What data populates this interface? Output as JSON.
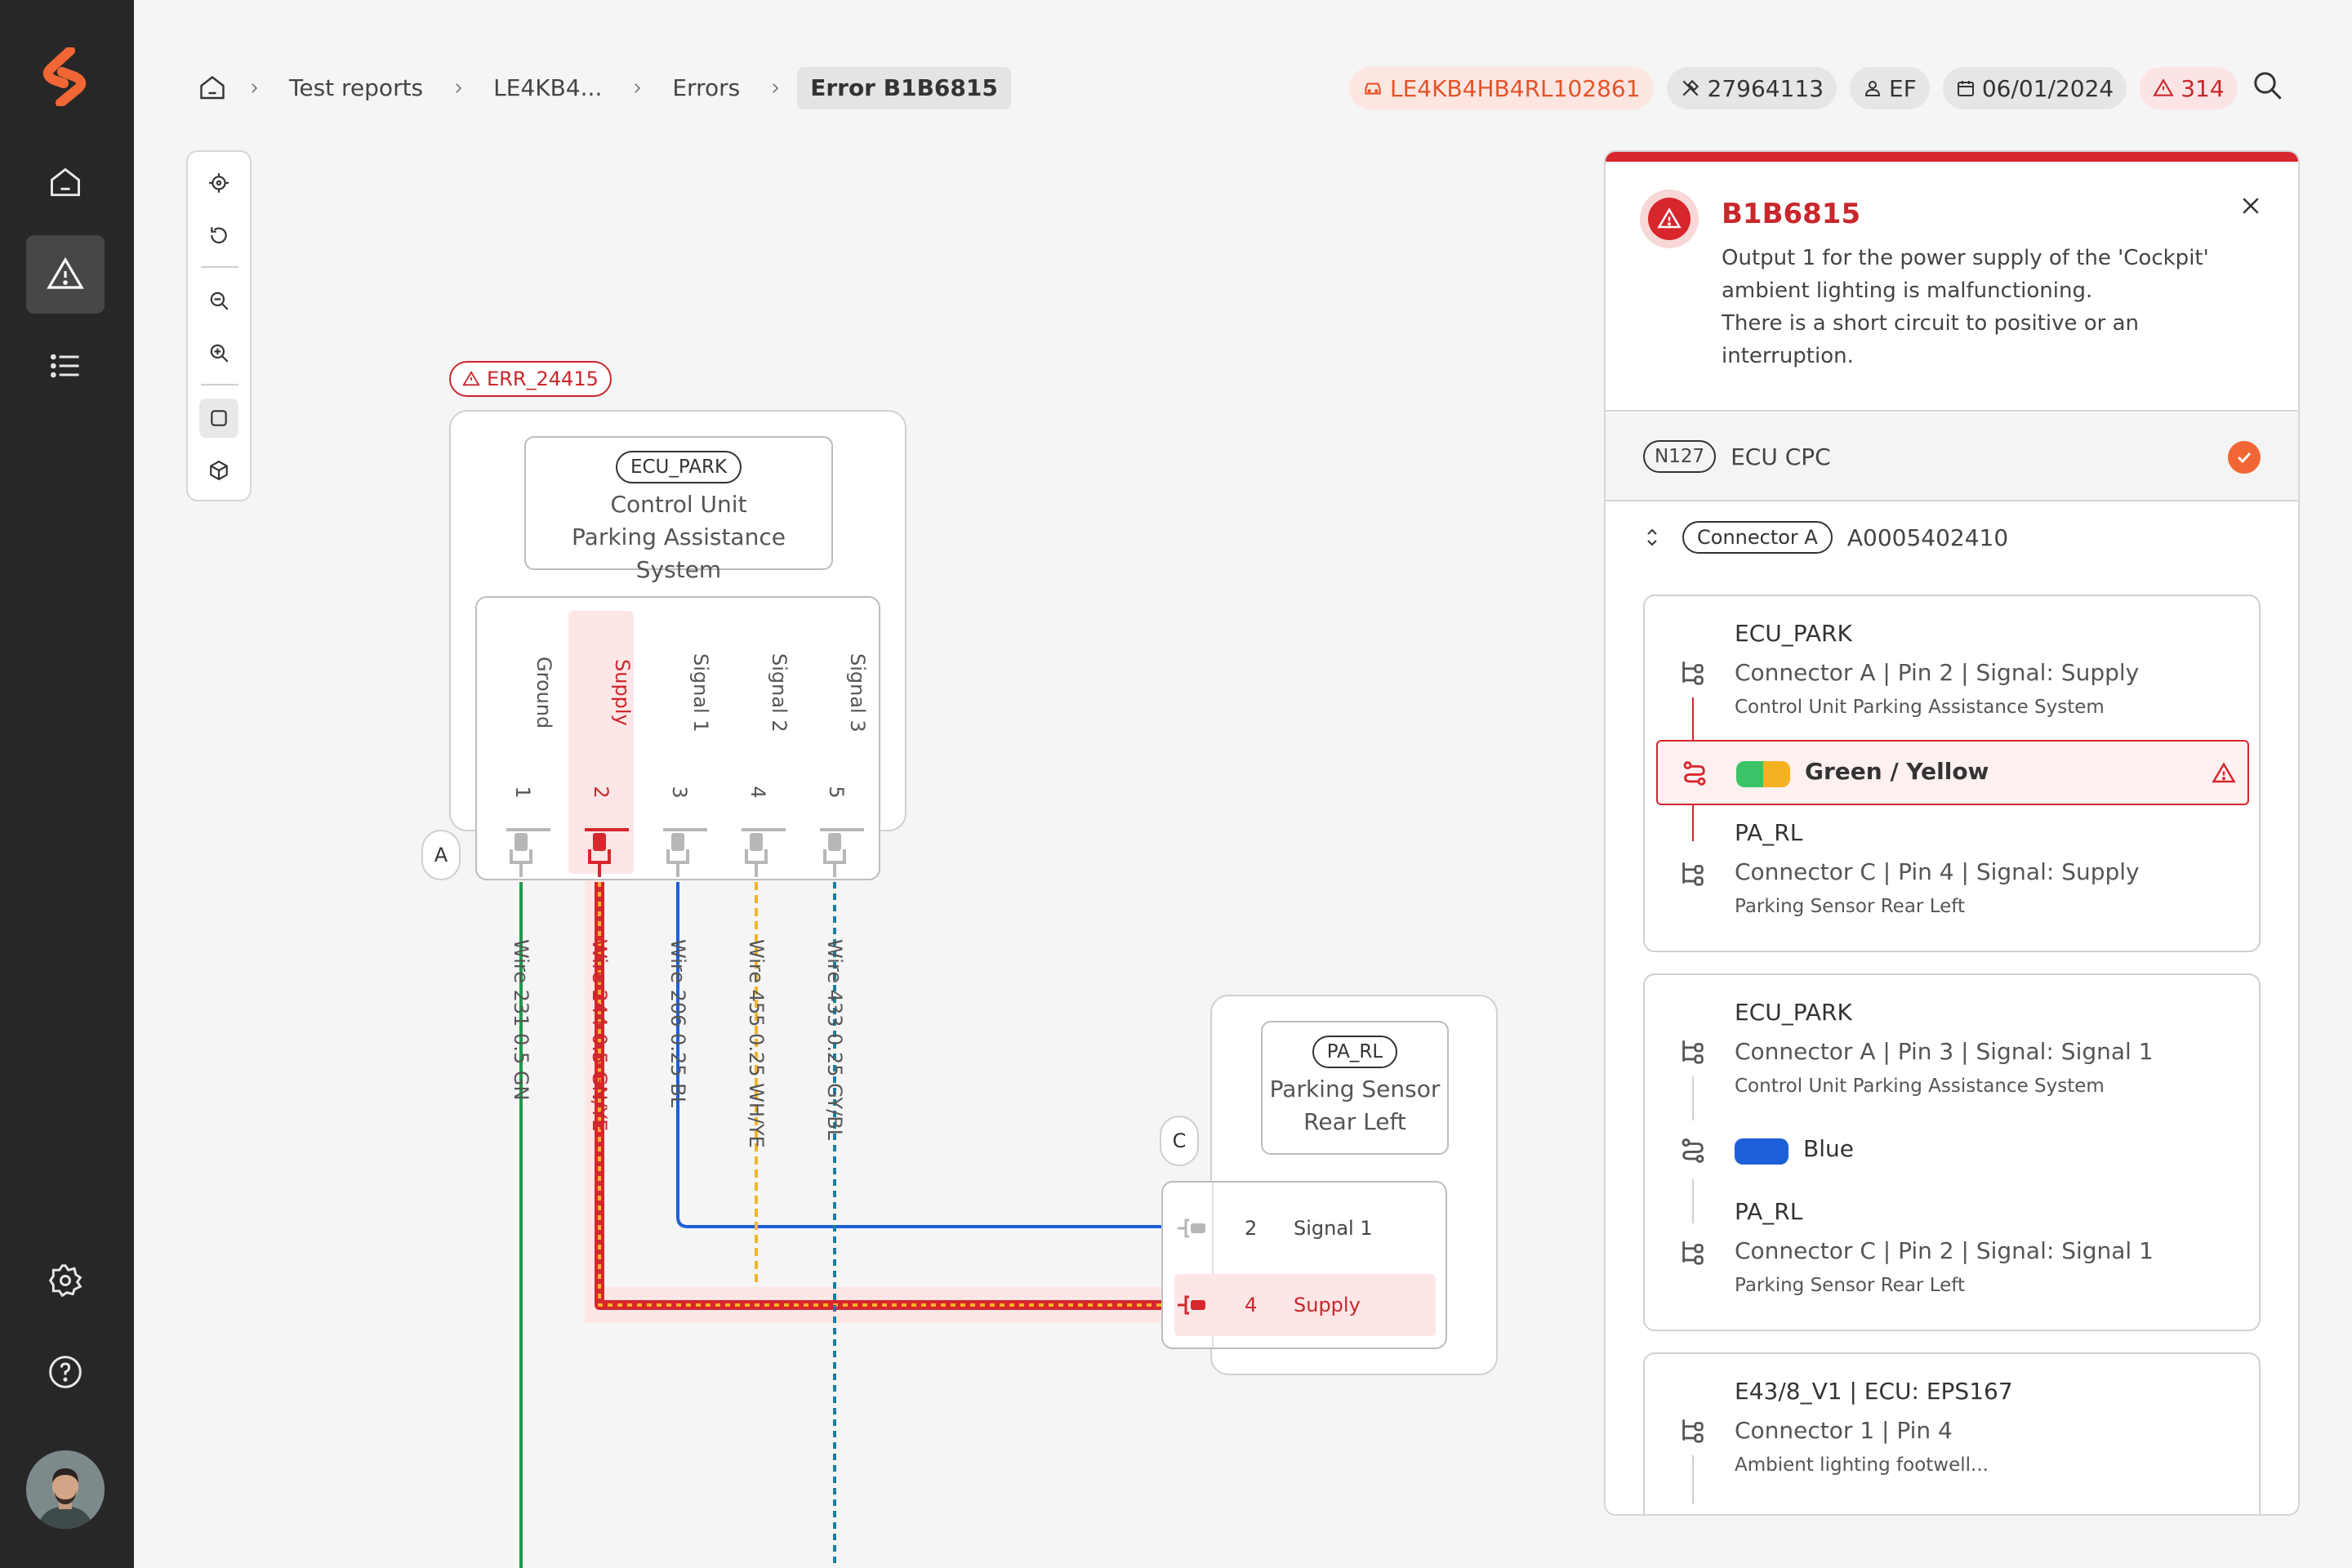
{
  "breadcrumbs": [
    "Test reports",
    "LE4KB4...",
    "Errors",
    "Error B1B6815"
  ],
  "chips": {
    "vin": "LE4KB4HB4RL102861",
    "order": "27964113",
    "user": "EF",
    "date": "06/01/2024",
    "errors": "314"
  },
  "diagram": {
    "error_tag": "ERR_24415",
    "ecu": {
      "code": "ECU_PARK",
      "line1": "Control Unit",
      "line2": "Parking Assistance System",
      "connector": "A"
    },
    "pins": [
      {
        "label": "Ground",
        "num": "1"
      },
      {
        "label": "Supply",
        "num": "2"
      },
      {
        "label": "Signal 1",
        "num": "3"
      },
      {
        "label": "Signal 2",
        "num": "4"
      },
      {
        "label": "Signal 3",
        "num": "5"
      }
    ],
    "wires": [
      {
        "label": "Wire 231  0.5  GN",
        "color": "#1e9a4b"
      },
      {
        "label": "Wire 244  0.5  GN/YE",
        "color": "#d7262c"
      },
      {
        "label": "Wire 206  0.25  BL",
        "color": "#1d5fd8"
      },
      {
        "label": "Wire 455  0.25  WH/YE",
        "color": "#f2b528"
      },
      {
        "label": "Wire 433  0.25  GY/BL",
        "color": "#1a7fa0"
      }
    ],
    "sensor": {
      "code": "PA_RL",
      "line1": "Parking Sensor",
      "line2": "Rear Left",
      "connector": "C"
    },
    "sensor_pins": [
      {
        "num": "2",
        "label": "Signal 1"
      },
      {
        "num": "4",
        "label": "Supply"
      }
    ]
  },
  "panel": {
    "code": "B1B6815",
    "desc1": "Output 1 for the power supply of the 'Cockpit' ambient lighting is malfunctioning.",
    "desc2": "There is a short circuit to positive or an interruption.",
    "ecu_badge": "N127",
    "ecu_name": "ECU CPC",
    "connector_badge": "Connector A",
    "connector_part": "A0005402410",
    "cards": [
      {
        "from_name": "ECU_PARK",
        "from_detail": "Connector A | Pin 2 | Signal: Supply",
        "from_desc": "Control Unit Parking Assistance System",
        "wire": "Green / Yellow",
        "to_name": "PA_RL",
        "to_detail": "Connector C | Pin 4 | Signal: Supply",
        "to_desc": "Parking Sensor Rear Left"
      },
      {
        "from_name": "ECU_PARK",
        "from_detail": "Connector A | Pin 3 | Signal: Signal 1",
        "from_desc": "Control Unit Parking Assistance System",
        "wire": "Blue",
        "to_name": "PA_RL",
        "to_detail": "Connector C | Pin 2 | Signal: Signal 1",
        "to_desc": "Parking Sensor Rear Left"
      },
      {
        "from_name": "E43/8_V1 | ECU: EPS167",
        "from_detail": "Connector 1 | Pin 4",
        "from_desc": "Ambient lighting footwell..."
      }
    ]
  },
  "colors": {
    "accent": "#f06735",
    "error": "#d7262c",
    "sidebar": "#272727"
  }
}
